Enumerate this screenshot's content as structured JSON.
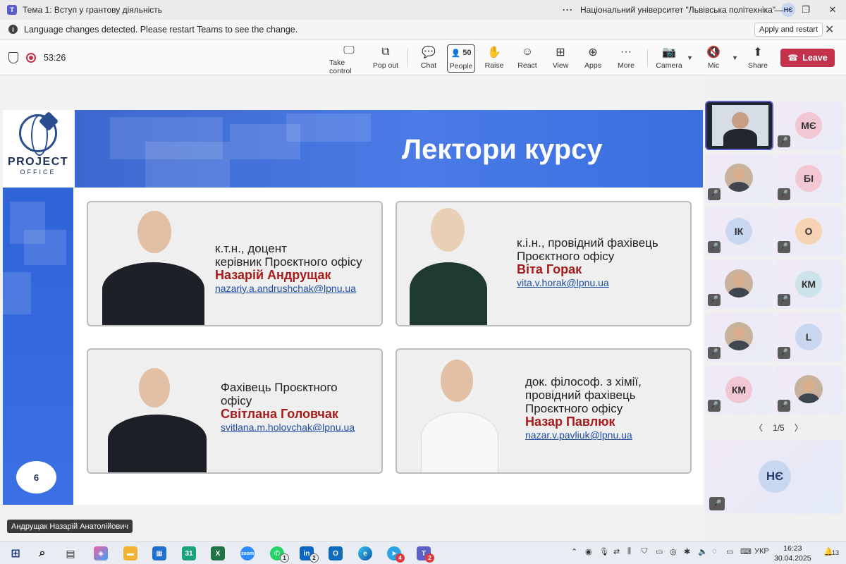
{
  "window": {
    "title": "Тема 1: Вступ у грантову діяльність",
    "org": "Національний університет \"Львівська політехніка\"",
    "user_initials": "НЄ",
    "app_logo": "T"
  },
  "notification": {
    "message": "Language changes detected. Please restart Teams to see the change.",
    "restart_label": "Apply and restart"
  },
  "meeting": {
    "timer": "53:26",
    "people_count": "50",
    "buttons": {
      "take_control": "Take control",
      "pop_out": "Pop out",
      "chat": "Chat",
      "people": "People",
      "raise": "Raise",
      "react": "React",
      "view": "View",
      "apps": "Apps",
      "more": "More",
      "camera": "Camera",
      "mic": "Mic",
      "share": "Share",
      "leave": "Leave"
    }
  },
  "slide": {
    "logo_line1": "PROJECT",
    "logo_line2": "OFFICE",
    "heading": "Лектори курсу",
    "page_number": "6",
    "lecturers": [
      {
        "line1": "к.т.н., доцент",
        "line2": "керівник Проєктного офісу",
        "line3": "",
        "name": "Назарій Андрущак",
        "email": "nazariy.a.andrushchak@lpnu.ua"
      },
      {
        "line1": "к.і.н., провідний фахівець",
        "line2": "Проєктного офісу",
        "line3": "",
        "name": "Віта Горак",
        "email": "vita.v.horak@lpnu.ua"
      },
      {
        "line1": "Фахівець Проєктного",
        "line2": "офісу",
        "line3": "",
        "name": "Світлана Головчак",
        "email": "svitlana.m.holovchak@lpnu.ua"
      },
      {
        "line1": "док. філософ. з хімії,",
        "line2": "провідний фахівець",
        "line3": "Проєктного офісу",
        "name": "Назар Павлюк",
        "email": "nazar.v.pavliuk@lpnu.ua"
      }
    ]
  },
  "speaker_name": "Андрущак Назарій Анатолійович",
  "participants": {
    "tiles": [
      {
        "initials": "",
        "kind": "video",
        "color": ""
      },
      {
        "initials": "МЄ",
        "kind": "initials",
        "color": "#f3c6d3"
      },
      {
        "initials": "",
        "kind": "photo",
        "color": ""
      },
      {
        "initials": "БІ",
        "kind": "initials",
        "color": "#f3c6d3"
      },
      {
        "initials": "ІК",
        "kind": "initials",
        "color": "#c9d6ef"
      },
      {
        "initials": "О",
        "kind": "initials",
        "color": "#f6d3b3"
      },
      {
        "initials": "",
        "kind": "photo",
        "color": ""
      },
      {
        "initials": "КМ",
        "kind": "initials",
        "color": "#cde3ea"
      },
      {
        "initials": "",
        "kind": "photo",
        "color": ""
      },
      {
        "initials": "L",
        "kind": "initials",
        "color": "#c9d6ef"
      },
      {
        "initials": "КМ",
        "kind": "initials",
        "color": "#f3c6d3"
      },
      {
        "initials": "",
        "kind": "photo",
        "color": ""
      }
    ],
    "page": "1/5",
    "self_initials": "НЄ"
  },
  "taskbar": {
    "badges": {
      "whatsapp": "1",
      "linkedin": "2",
      "telegram": "4",
      "teams": "2"
    },
    "lang": "УКР",
    "time": "16:23",
    "date": "30.04.2025",
    "notifications": "13"
  }
}
